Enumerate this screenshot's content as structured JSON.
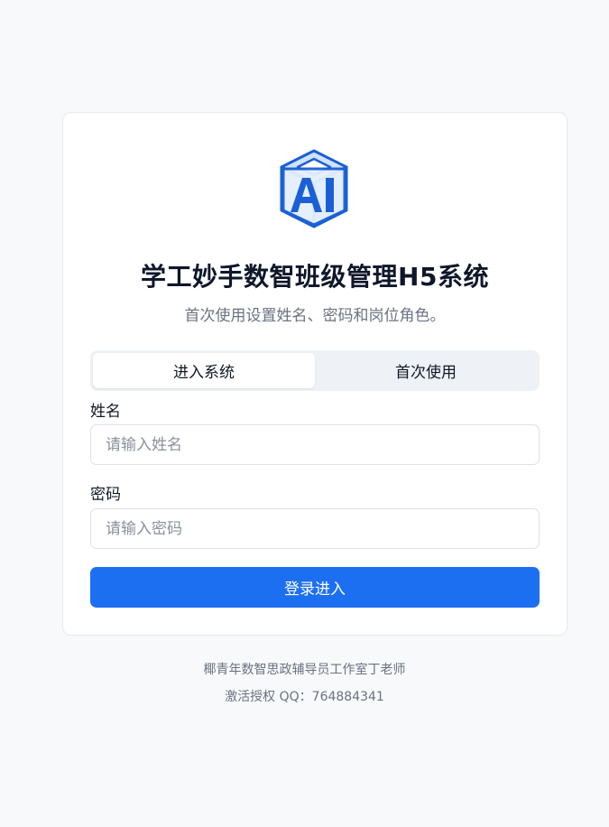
{
  "app": {
    "title": "学工妙手数智班级管理H5系统",
    "subtitle": "首次使用设置姓名、密码和岗位角色。",
    "logo_icon": "ai-cube-icon",
    "accent_color": "#1d6ff2"
  },
  "tabs": [
    {
      "label": "进入系统",
      "active": true
    },
    {
      "label": "首次使用",
      "active": false
    }
  ],
  "form": {
    "name_label": "姓名",
    "name_placeholder": "请输入姓名",
    "password_label": "密码",
    "password_placeholder": "请输入密码",
    "submit_label": "登录进入"
  },
  "footer": {
    "line1": "椰青年数智思政辅导员工作室丁老师",
    "line2": "激活授权 QQ：764884341"
  }
}
